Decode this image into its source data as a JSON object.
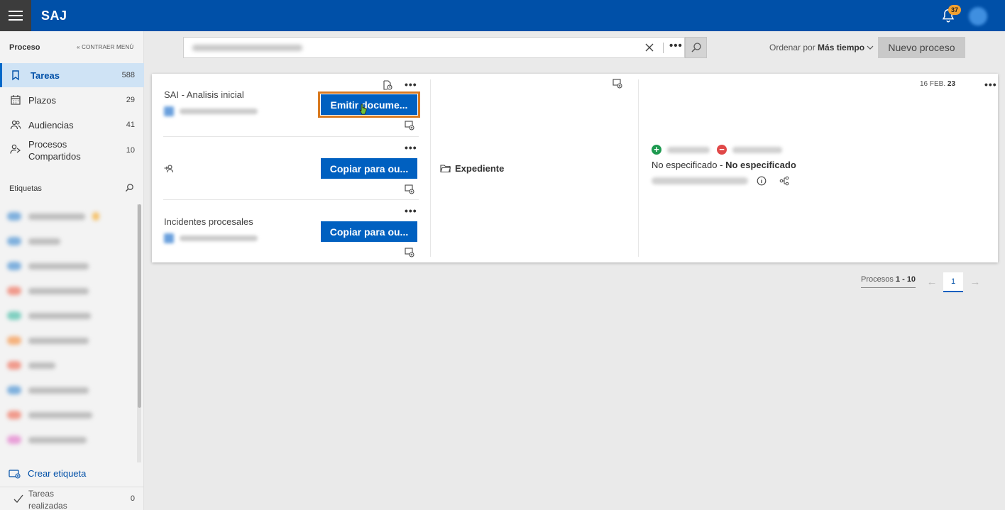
{
  "app": {
    "brand": "SAJ",
    "notifications": "37"
  },
  "sidebar": {
    "section": "Proceso",
    "collapse": "« CONTRAER MENÚ",
    "items": [
      {
        "label": "Tareas",
        "count": "588"
      },
      {
        "label": "Plazos",
        "count": "29"
      },
      {
        "label": "Audiencias",
        "count": "41"
      },
      {
        "label": "Procesos\nCompartidos",
        "count": "10"
      }
    ],
    "tags_header": "Etiquetas",
    "create_tag": "Crear etiqueta",
    "done": {
      "label": "Tareas realizadas",
      "count": "0"
    }
  },
  "toolbar": {
    "sort_prefix": "Ordenar por",
    "sort_value": "Más tiempo",
    "new_process": "Nuevo proceso"
  },
  "card": {
    "tasks": [
      {
        "title": "SAI - Analisis inicial",
        "action": "Emitir docume..."
      },
      {
        "title": "",
        "action": "Copiar para ou..."
      },
      {
        "title": "Incidentes procesales",
        "action": "Copiar para ou..."
      }
    ],
    "folder": "Expediente",
    "date_day": "16 FEB.",
    "date_year": "23",
    "spec_left": "No especificado",
    "spec_sep": " - ",
    "spec_right": "No especificado"
  },
  "pagination": {
    "label": "Procesos",
    "range": "1 - 10",
    "page": "1"
  },
  "colors": {
    "header": "#0050a8",
    "button": "#0060c0",
    "focus": "#d97a20"
  }
}
